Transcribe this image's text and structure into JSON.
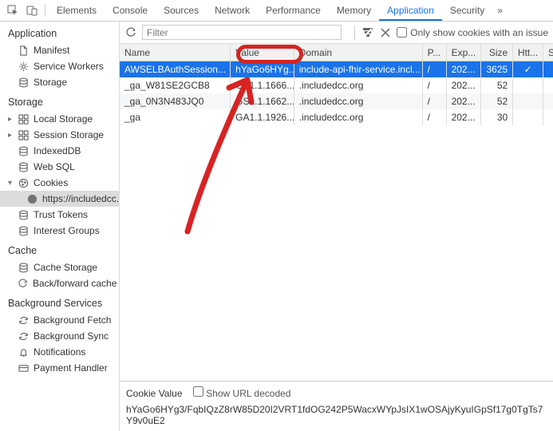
{
  "tabs": [
    "Elements",
    "Console",
    "Sources",
    "Network",
    "Performance",
    "Memory",
    "Application",
    "Security"
  ],
  "active_tab": "Application",
  "sidebar": {
    "groups": [
      {
        "title": "Application",
        "items": [
          {
            "icon": "file",
            "label": "Manifest"
          },
          {
            "icon": "gear",
            "label": "Service Workers"
          },
          {
            "icon": "db",
            "label": "Storage"
          }
        ]
      },
      {
        "title": "Storage",
        "items": [
          {
            "tri": "▸",
            "icon": "grid",
            "label": "Local Storage"
          },
          {
            "tri": "▸",
            "icon": "grid",
            "label": "Session Storage"
          },
          {
            "icon": "db",
            "label": "IndexedDB"
          },
          {
            "icon": "db",
            "label": "Web SQL"
          },
          {
            "tri": "▾",
            "icon": "cookie",
            "label": "Cookies",
            "expanded": true,
            "children": [
              {
                "icon": "cookiesel",
                "label": "https://includedcc.org",
                "selected": true
              }
            ]
          },
          {
            "icon": "db",
            "label": "Trust Tokens"
          },
          {
            "icon": "db",
            "label": "Interest Groups"
          }
        ]
      },
      {
        "title": "Cache",
        "items": [
          {
            "icon": "db",
            "label": "Cache Storage"
          },
          {
            "icon": "reload",
            "label": "Back/forward cache"
          }
        ]
      },
      {
        "title": "Background Services",
        "items": [
          {
            "icon": "sync",
            "label": "Background Fetch"
          },
          {
            "icon": "sync",
            "label": "Background Sync"
          },
          {
            "icon": "bell",
            "label": "Notifications"
          },
          {
            "icon": "card",
            "label": "Payment Handler"
          }
        ]
      }
    ]
  },
  "filter_placeholder": "Filter",
  "only_issues_label": "Only show cookies with an issue",
  "columns": [
    "Name",
    "Value",
    "Domain",
    "P...",
    "Exp...",
    "Size",
    "Htt...",
    "Se..."
  ],
  "rows": [
    {
      "name": "AWSELBAuthSession...",
      "value": "hYaGo6HYg...",
      "domain": "include-api-fhir-service.incl...",
      "path": "/",
      "exp": "202...",
      "size": "3625",
      "http": "✓",
      "selected": true
    },
    {
      "name": "_ga_W81SE2GCB8",
      "value": "GS1.1.1666...",
      "domain": ".includedcc.org",
      "path": "/",
      "exp": "202...",
      "size": "52",
      "http": ""
    },
    {
      "name": "_ga_0N3N483JQ0",
      "value": "GS1.1.1662...",
      "domain": ".includedcc.org",
      "path": "/",
      "exp": "202...",
      "size": "52",
      "http": ""
    },
    {
      "name": "_ga",
      "value": "GA1.1.1926...",
      "domain": ".includedcc.org",
      "path": "/",
      "exp": "202...",
      "size": "30",
      "http": ""
    }
  ],
  "detail": {
    "label": "Cookie Value",
    "checkbox": "Show URL decoded",
    "value": "hYaGo6HYg3/FqbIQzZ8rW85D20I2VRT1fdOG242P5WacxWYpJsIX1wOSAjyKyuIGpSf17g0TgTs7Y9v0uE2"
  }
}
